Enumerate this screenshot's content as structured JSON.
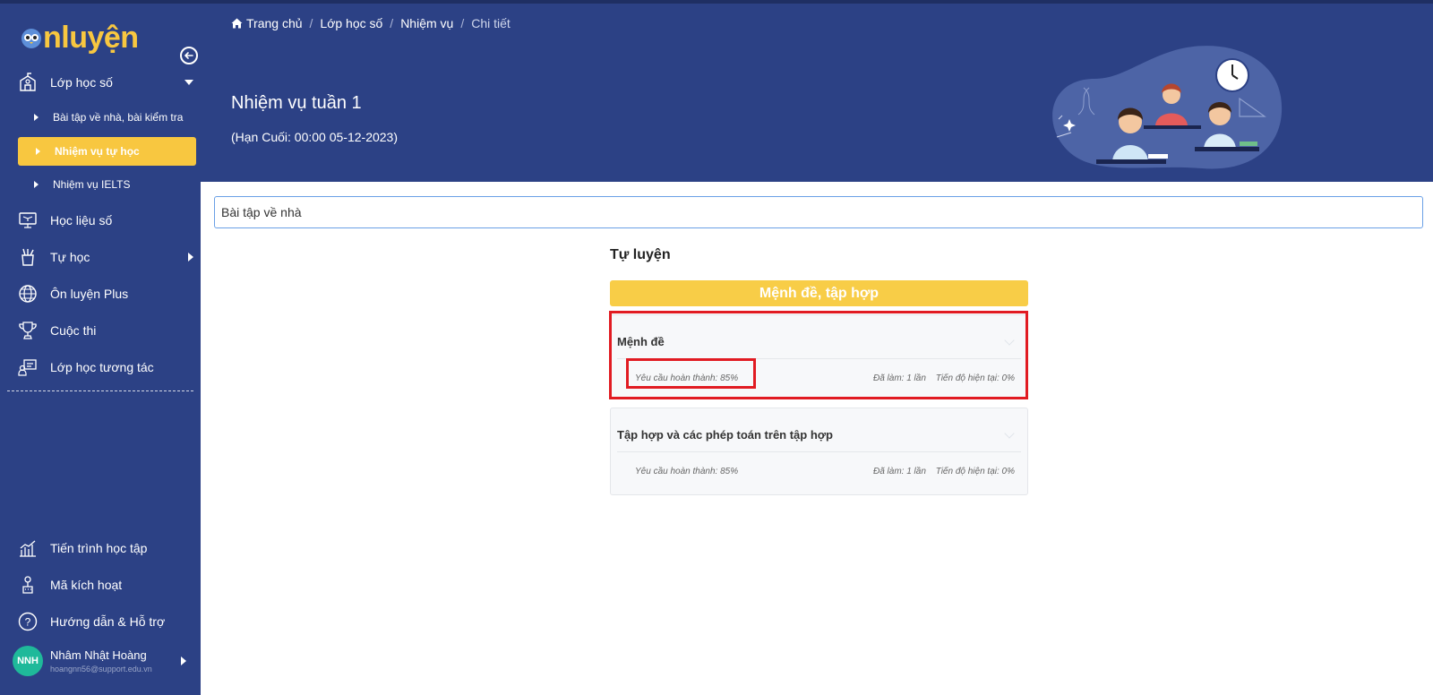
{
  "logo": {
    "text": "nluyện"
  },
  "sidebar": {
    "items": [
      {
        "label": "Lớp học số",
        "icon": "school-icon"
      },
      {
        "label": "Học liệu số",
        "icon": "monitor-book-icon"
      },
      {
        "label": "Tự học",
        "icon": "pencil-cup-icon"
      },
      {
        "label": "Ôn luyện Plus",
        "icon": "globe-icon"
      },
      {
        "label": "Cuộc thi",
        "icon": "trophy-icon"
      },
      {
        "label": "Lớp học tương tác",
        "icon": "interactive-class-icon"
      }
    ],
    "sub_items": [
      {
        "label": "Bài tập về nhà, bài kiểm tra"
      },
      {
        "label": "Nhiệm vụ tự học",
        "active": true
      },
      {
        "label": "Nhiệm vụ IELTS"
      }
    ],
    "bottom_items": [
      {
        "label": "Tiến trình học tập",
        "icon": "chart-icon"
      },
      {
        "label": "Mã kích hoạt",
        "icon": "activation-key-icon"
      },
      {
        "label": "Hướng dẫn & Hỗ trợ",
        "icon": "help-icon"
      }
    ],
    "user": {
      "initials": "NNH",
      "name": "Nhâm Nhật Hoàng",
      "email": "hoangnn56@support.edu.vn"
    }
  },
  "breadcrumb": [
    "Trang chủ",
    "Lớp học số",
    "Nhiệm vụ",
    "Chi tiết"
  ],
  "header": {
    "title": "Nhiệm vụ tuần 1",
    "deadline": "(Hạn Cuối: 00:00 05-12-2023)"
  },
  "search": {
    "value": "Bài tập về nhà"
  },
  "main": {
    "section_title": "Tự luyện",
    "topic": "Mệnh đề, tập hợp",
    "lessons": [
      {
        "name": "Mệnh đề",
        "requirement": "Yêu cầu hoàn thành: 85%",
        "attempts": "Đã làm: 1 lần",
        "progress": "Tiến độ hiện tại: 0%"
      },
      {
        "name": "Tập hợp và các phép toán trên tập hợp",
        "requirement": "Yêu cầu hoàn thành: 85%",
        "attempts": "Đã làm: 1 lần",
        "progress": "Tiến độ hiện tại: 0%"
      }
    ]
  },
  "colors": {
    "primary": "#2c4185",
    "accent": "#f8c740",
    "highlight": "#e11b22"
  }
}
